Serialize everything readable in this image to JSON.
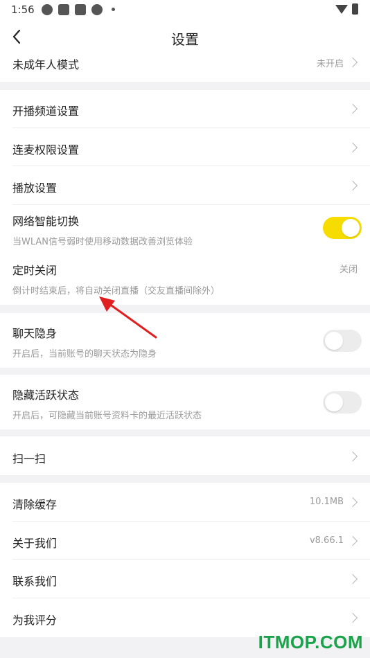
{
  "status_bar": {
    "time": "1:56"
  },
  "header": {
    "title": "设置",
    "back_icon": "back-arrow-icon"
  },
  "rows": {
    "minor_mode": {
      "label": "未成年人模式",
      "value": "未开启"
    },
    "channel": {
      "label": "开播频道设置"
    },
    "mic_permission": {
      "label": "连麦权限设置"
    },
    "playback": {
      "label": "播放设置"
    },
    "network": {
      "label": "网络智能切换",
      "sub": "当WLAN信号弱时使用移动数据改善浏览体验",
      "toggle_on": true
    },
    "timer_off": {
      "label": "定时关闭",
      "value": "关闭",
      "sub": "倒计时结束后，将自动关闭直播（交友直播间除外）"
    },
    "chat_invisible": {
      "label": "聊天隐身",
      "sub": "开启后，当前账号的聊天状态为隐身",
      "toggle_on": false
    },
    "hide_active": {
      "label": "隐藏活跃状态",
      "sub": "开启后，可隐藏当前账号资料卡的最近活跃状态",
      "toggle_on": false
    },
    "scan": {
      "label": "扫一扫"
    },
    "clear_cache": {
      "label": "清除缓存",
      "value": "10.1MB"
    },
    "about": {
      "label": "关于我们",
      "value": "v8.66.1"
    },
    "contact": {
      "label": "联系我们"
    },
    "rate": {
      "label": "为我评分"
    }
  },
  "colors": {
    "toggle_on": "#f7dc00",
    "annotation_arrow": "#e02020",
    "watermark": "#1aa34a"
  },
  "watermark": "ITMOP.COM"
}
